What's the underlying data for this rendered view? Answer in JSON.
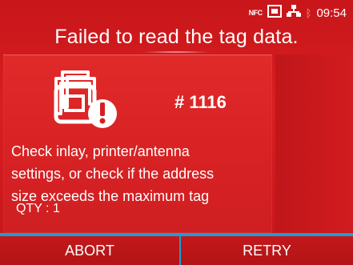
{
  "status_bar": {
    "nfc_label": "NFC",
    "printer_icon": "printer-icon",
    "network_icon": "network-icon",
    "bluetooth_icon": "bluetooth-icon",
    "time": "09:54"
  },
  "title": "Failed to read the tag data.",
  "error": {
    "icon": "rfid-tag-error-icon",
    "code": "# 1116",
    "message": "Check inlay, printer/antenna\nsettings, or check if the address\nsize exceeds the maximum tag",
    "qty": "QTY : 1"
  },
  "buttons": {
    "abort_label": "ABORT",
    "retry_label": "RETRY"
  },
  "colors": {
    "background_red": "#d81e20",
    "button_bar_blue": "#1a9ed8",
    "text": "#ffffff"
  }
}
